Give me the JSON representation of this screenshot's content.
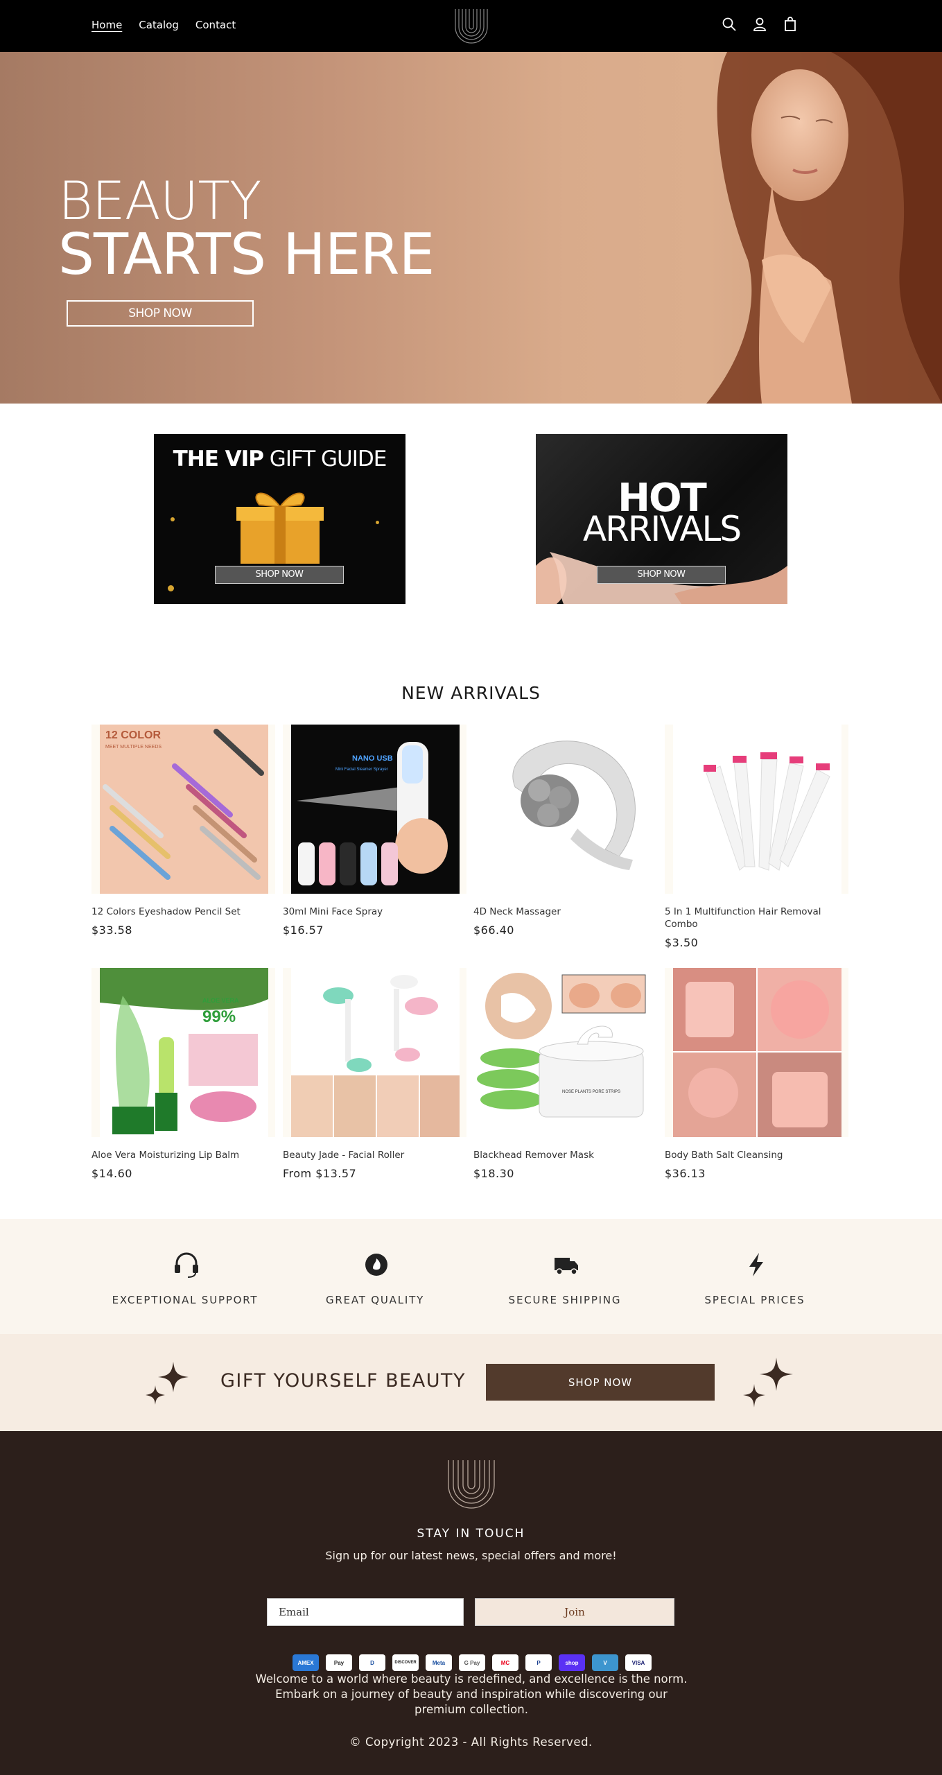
{
  "header": {
    "nav": [
      "Home",
      "Catalog",
      "Contact"
    ],
    "icons": [
      "search-icon",
      "account-icon",
      "cart-icon"
    ]
  },
  "hero": {
    "line1": "BEAUTY",
    "line2": "STARTS HERE",
    "button": "SHOP NOW"
  },
  "promos": {
    "vip": {
      "title_bold": "THE VIP",
      "title_rest": " GIFT GUIDE",
      "button": "SHOP NOW"
    },
    "hot": {
      "line1": "HOT",
      "line2": "ARRIVALS",
      "button": "SHOP NOW"
    }
  },
  "new_arrivals": {
    "title": "NEW ARRIVALS",
    "products": [
      {
        "name": "12 Colors Eyeshadow Pencil Set",
        "price": "$33.58",
        "image_text": "12 COLOR",
        "image_subtext": "MEET MULTIPLE NEEDS"
      },
      {
        "name": "30ml Mini Face Spray",
        "price": "$16.57",
        "image_text": "NANO USB",
        "image_subtext": "Mini Facial Steamer Sprayer"
      },
      {
        "name": "4D Neck Massager",
        "price": "$66.40"
      },
      {
        "name": "5 In 1 Multifunction Hair Removal Combo",
        "price": "$3.50"
      },
      {
        "name": "Aloe Vera Moisturizing Lip Balm",
        "price": "$14.60",
        "image_text": "ALOE VERA",
        "image_subtext": "99%"
      },
      {
        "name": "Beauty Jade - Facial Roller",
        "price": "From $13.57"
      },
      {
        "name": "Blackhead Remover Mask",
        "price": "$18.30",
        "image_text": "NOSE PLANTS PORE STRIPS"
      },
      {
        "name": "Body Bath Salt Cleansing",
        "price": "$36.13"
      }
    ]
  },
  "features": [
    {
      "label": "EXCEPTIONAL SUPPORT",
      "icon": "headset-icon"
    },
    {
      "label": "GREAT QUALITY",
      "icon": "quality-badge-icon"
    },
    {
      "label": "SECURE SHIPPING",
      "icon": "truck-icon"
    },
    {
      "label": "SPECIAL PRICES",
      "icon": "lightning-icon"
    }
  ],
  "cta": {
    "text": "GIFT YOURSELF BEAUTY",
    "button": "SHOP NOW"
  },
  "footer": {
    "stay": "STAY IN TOUCH",
    "signup": "Sign up for our latest news, special offers and more!",
    "email_placeholder": "Email",
    "join": "Join",
    "payments": [
      "AMEX",
      "Pay",
      "D",
      "DISCOVER",
      "Meta",
      "G Pay",
      "MC",
      "P",
      "shop",
      "V",
      "VISA"
    ],
    "welcome": "Welcome to a world where beauty is redefined, and excellence is the norm. Embark on a journey of beauty and inspiration while discovering our premium collection.",
    "copyright": "© Copyright 2023 - All Rights Reserved."
  },
  "colors": {
    "header_bg": "#000000",
    "features_bg": "#faf5ee",
    "cta_bg": "#f6ece2",
    "cta_button": "#523a2c",
    "footer_bg": "#2c1f1b"
  }
}
